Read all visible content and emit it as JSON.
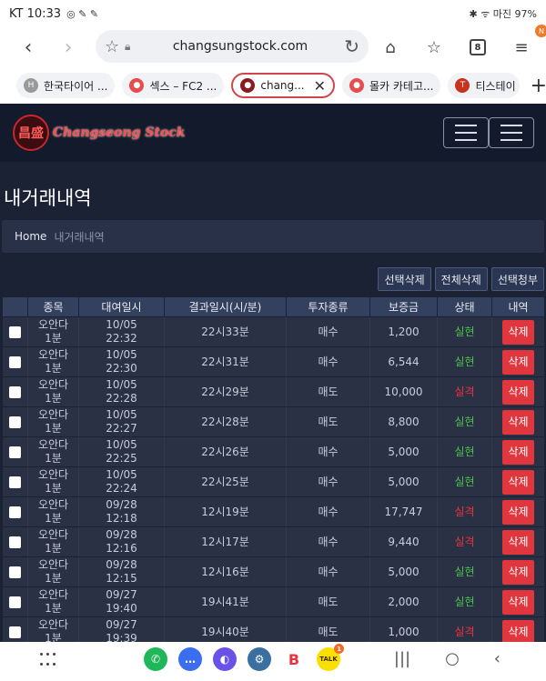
{
  "status_bar": {
    "carrier_time": "KT 10:33",
    "right_icons": "✱ ᯤ 마진 97%"
  },
  "browser": {
    "url": "changsungstock.com",
    "tab_count": "8",
    "menu_badge": "N",
    "tabs": [
      {
        "label": "한국타이어 ..."
      },
      {
        "label": "섹스 – FC2 ..."
      },
      {
        "label": "chang..."
      },
      {
        "label": "몰카 카테고..."
      },
      {
        "label": "티스테이"
      }
    ]
  },
  "site": {
    "logo_text": "Changseong Stock",
    "logo_emblem": "昌盛",
    "page_title": "내거래내역",
    "breadcrumb_home": "Home",
    "breadcrumb_current": "내거래내역"
  },
  "actions": {
    "delete_selected": "선택삭제",
    "delete_all": "전체삭제",
    "claim_selected": "선택청부"
  },
  "table": {
    "headers": [
      "",
      "종목",
      "대여일시",
      "결과일시(시/분)",
      "투자종류",
      "보증금",
      "상태",
      "내역"
    ],
    "rows": [
      {
        "item": "오안다",
        "unit": "1분",
        "date": "10/05",
        "time": "22:32",
        "result_time": "22시33분",
        "type": "매수",
        "deposit": "1,200",
        "status": "실현",
        "status_kind": "win",
        "action": "삭제"
      },
      {
        "item": "오안다",
        "unit": "1분",
        "date": "10/05",
        "time": "22:30",
        "result_time": "22시31분",
        "type": "매수",
        "deposit": "6,544",
        "status": "실현",
        "status_kind": "win",
        "action": "삭제"
      },
      {
        "item": "오안다",
        "unit": "1분",
        "date": "10/05",
        "time": "22:28",
        "result_time": "22시29분",
        "type": "매도",
        "deposit": "10,000",
        "status": "실격",
        "status_kind": "lose",
        "action": "삭제"
      },
      {
        "item": "오안다",
        "unit": "1분",
        "date": "10/05",
        "time": "22:27",
        "result_time": "22시28분",
        "type": "매도",
        "deposit": "8,800",
        "status": "실현",
        "status_kind": "win",
        "action": "삭제"
      },
      {
        "item": "오안다",
        "unit": "1분",
        "date": "10/05",
        "time": "22:25",
        "result_time": "22시26분",
        "type": "매수",
        "deposit": "5,000",
        "status": "실현",
        "status_kind": "win",
        "action": "삭제"
      },
      {
        "item": "오안다",
        "unit": "1분",
        "date": "10/05",
        "time": "22:24",
        "result_time": "22시25분",
        "type": "매수",
        "deposit": "5,000",
        "status": "실현",
        "status_kind": "win",
        "action": "삭제"
      },
      {
        "item": "오안다",
        "unit": "1분",
        "date": "09/28",
        "time": "12:18",
        "result_time": "12시19분",
        "type": "매수",
        "deposit": "17,747",
        "status": "실격",
        "status_kind": "lose",
        "action": "삭제"
      },
      {
        "item": "오안다",
        "unit": "1분",
        "date": "09/28",
        "time": "12:16",
        "result_time": "12시17분",
        "type": "매수",
        "deposit": "9,440",
        "status": "실격",
        "status_kind": "lose",
        "action": "삭제"
      },
      {
        "item": "오안다",
        "unit": "1분",
        "date": "09/28",
        "time": "12:15",
        "result_time": "12시16분",
        "type": "매수",
        "deposit": "5,000",
        "status": "실현",
        "status_kind": "win",
        "action": "삭제"
      },
      {
        "item": "오안다",
        "unit": "1분",
        "date": "09/27",
        "time": "19:40",
        "result_time": "19시41분",
        "type": "매도",
        "deposit": "2,000",
        "status": "실현",
        "status_kind": "win",
        "action": "삭제"
      },
      {
        "item": "오안다",
        "unit": "1분",
        "date": "09/27",
        "time": "19:39",
        "result_time": "19시40분",
        "type": "매도",
        "deposit": "1,000",
        "status": "실격",
        "status_kind": "lose",
        "action": "삭제"
      }
    ]
  },
  "dock_apps": [
    {
      "icon": "phone-icon",
      "color": "#1fb75a"
    },
    {
      "icon": "messages-icon",
      "color": "#3a6df0"
    },
    {
      "icon": "internet-icon",
      "color": "#6a52e8"
    },
    {
      "icon": "settings-icon",
      "color": "#3b6fa0"
    },
    {
      "icon": "band-icon",
      "label": "B",
      "color": "#ffffff"
    },
    {
      "icon": "kakaotalk-icon",
      "label": "TALK",
      "color": "#f9e000",
      "badge": "1"
    }
  ],
  "colors": {
    "win": "#4cc14c",
    "lose": "#e8343f",
    "delete_button": "#e0363d",
    "accent_tab": "#d0444a"
  }
}
